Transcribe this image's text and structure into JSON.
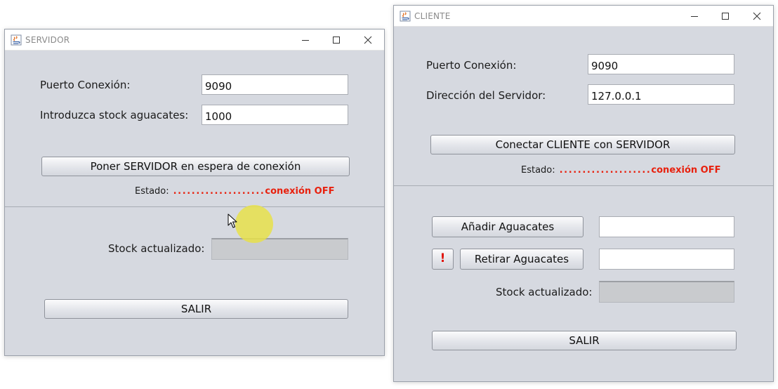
{
  "servidor": {
    "title": "SERVIDOR",
    "puerto_label": "Puerto Conexión:",
    "puerto_value": "9090",
    "stock_label": "Introduzca stock aguacates:",
    "stock_value": "1000",
    "wait_button": "Poner SERVIDOR en espera de conexión",
    "estado_label": "Estado:",
    "estado_dots": "....................",
    "estado_value": "conexión OFF",
    "stock_actualizado_label": "Stock actualizado:",
    "stock_actualizado_value": "",
    "salir_button": "SALIR"
  },
  "cliente": {
    "title": "CLIENTE",
    "puerto_label": "Puerto Conexión:",
    "puerto_value": "9090",
    "direccion_label": "Dirección del Servidor:",
    "direccion_value": "127.0.0.1",
    "connect_button": "Conectar CLIENTE con SERVIDOR",
    "estado_label": "Estado:",
    "estado_dots": "....................",
    "estado_value": "conexión OFF",
    "anadir_button": "Añadir Aguacates",
    "anadir_value": "",
    "alert_button": "!",
    "retirar_button": "Retirar Aguacates",
    "retirar_value": "",
    "stock_actualizado_label": "Stock actualizado:",
    "stock_actualizado_value": "",
    "salir_button": "SALIR"
  },
  "colors": {
    "window_bg": "#d6d9e0",
    "status_red": "#e8200d",
    "highlight": "#e8e04a"
  },
  "icons": [
    "java-app-icon",
    "minimize-icon",
    "maximize-icon",
    "close-icon",
    "mouse-pointer-icon",
    "click-highlight-icon"
  ]
}
